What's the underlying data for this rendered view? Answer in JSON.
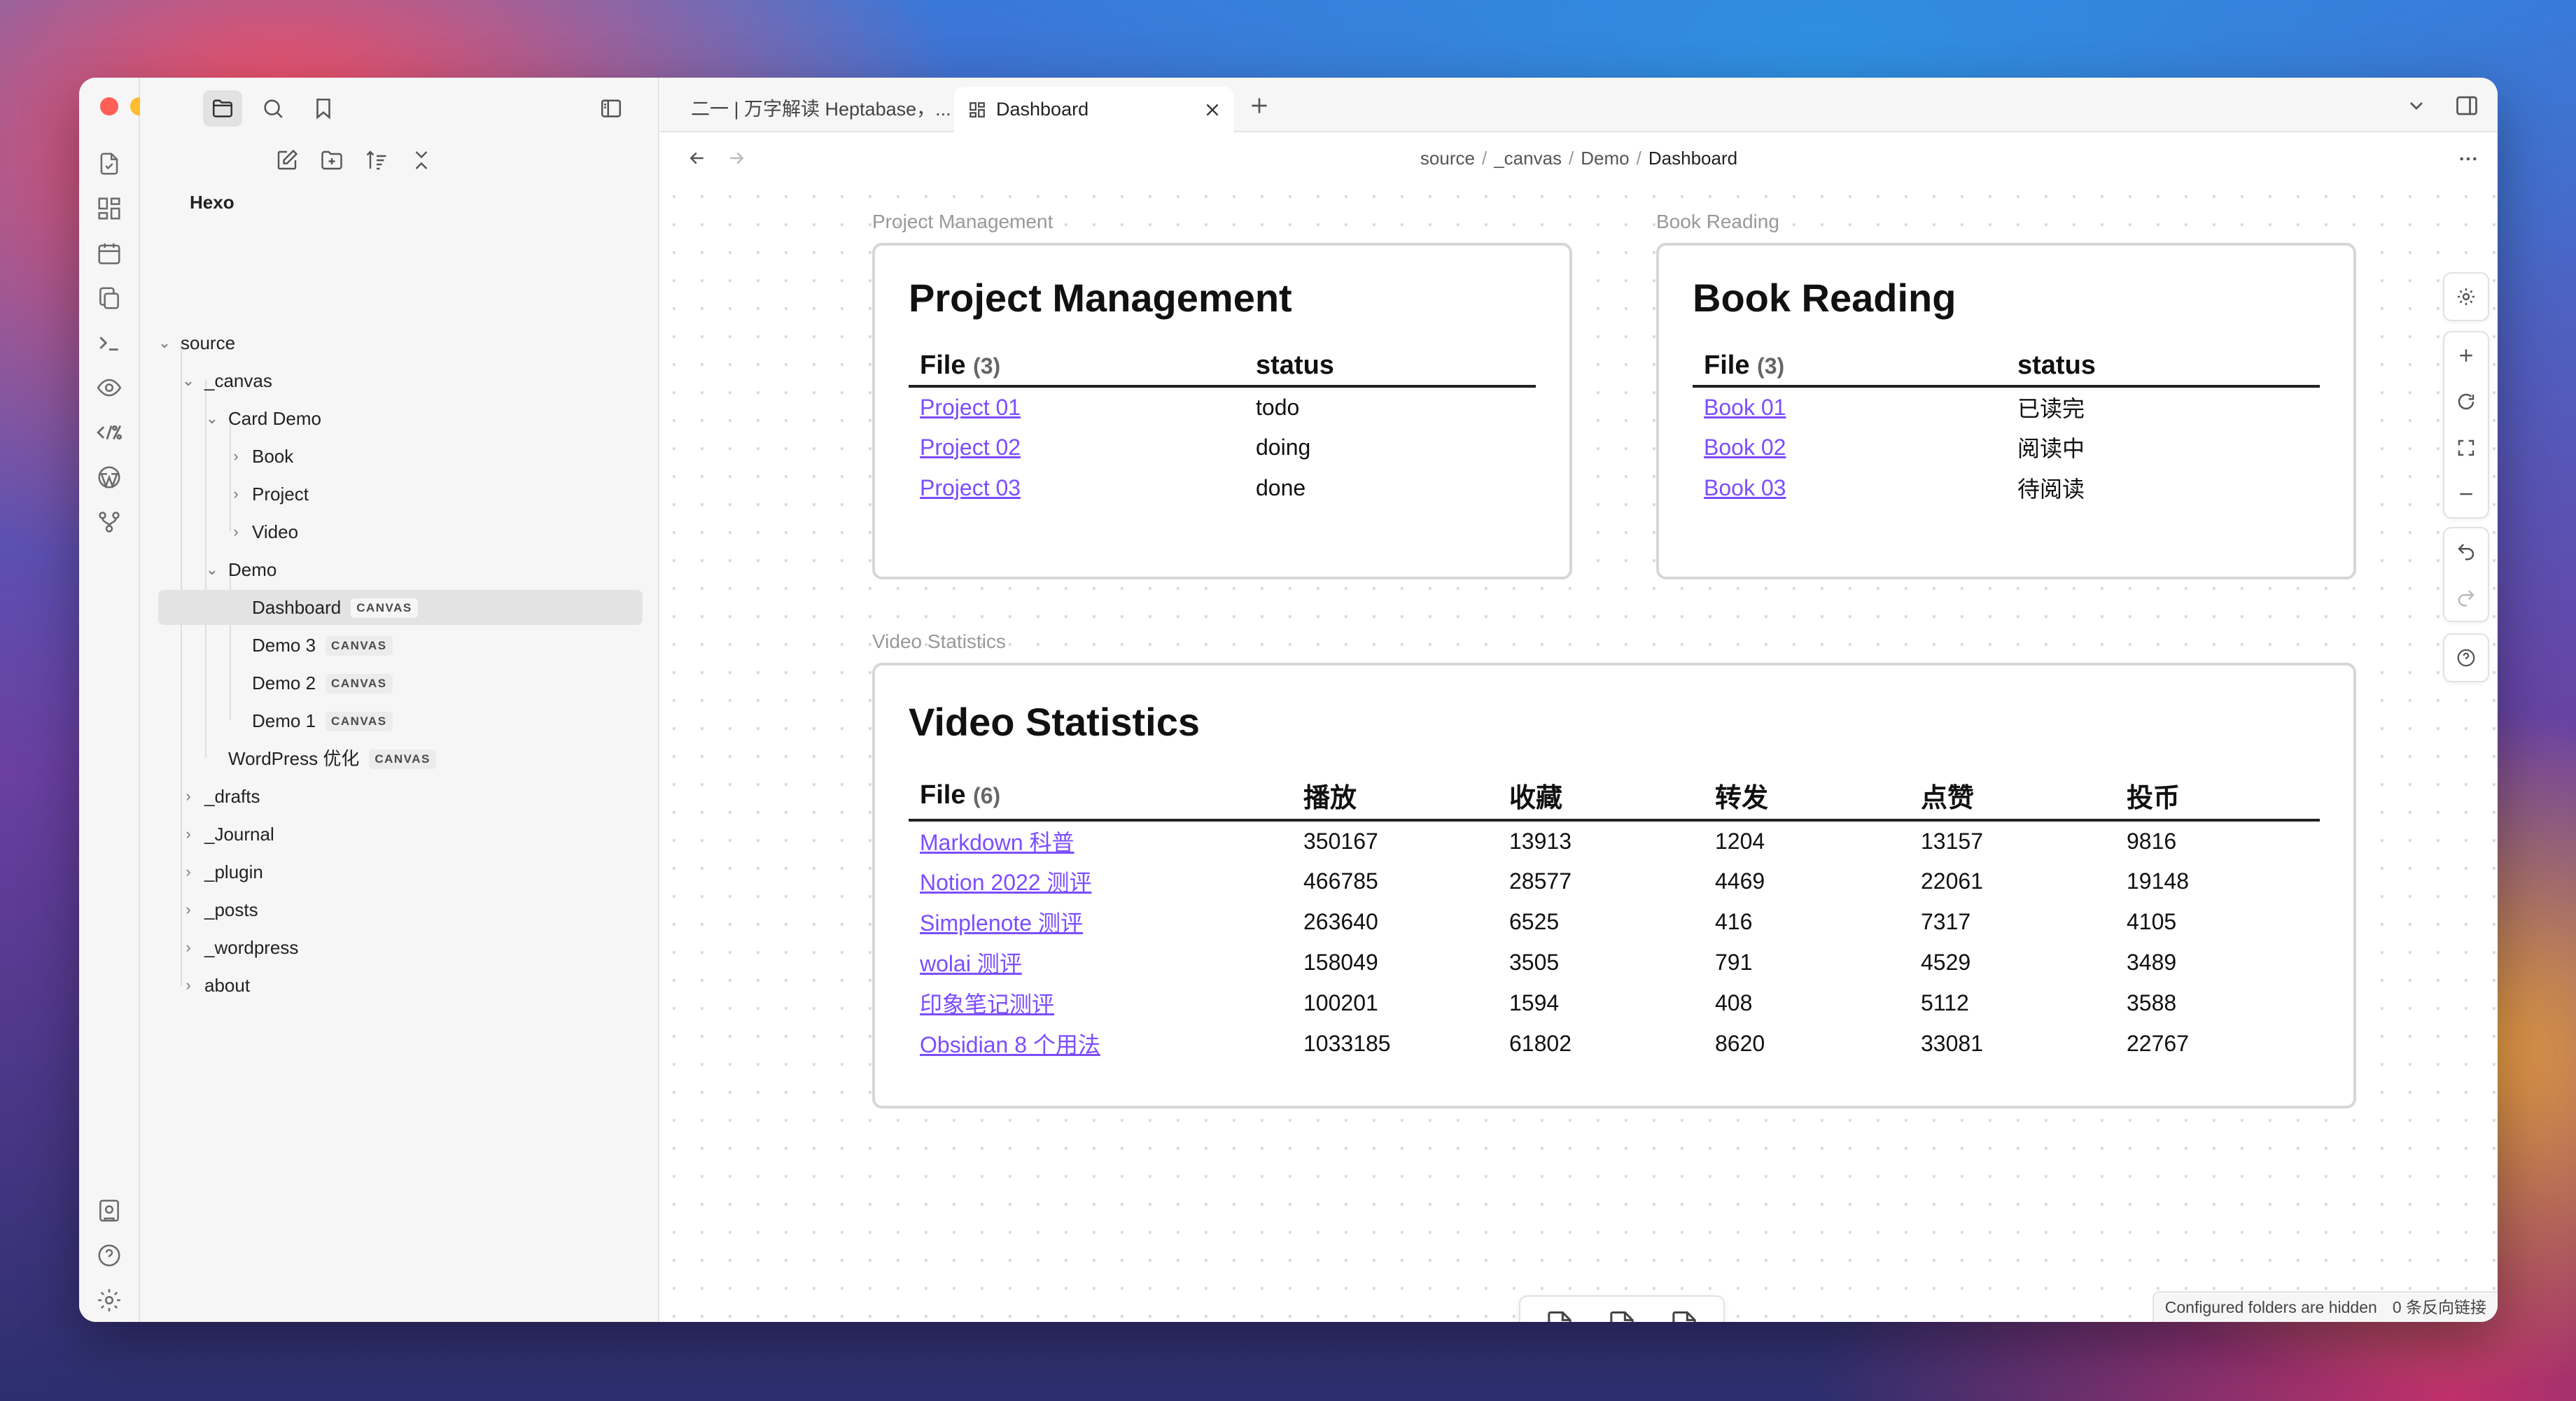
{
  "sidebar": {
    "root": "Hexo",
    "tree": [
      {
        "label": "source"
      },
      {
        "label": "_canvas"
      },
      {
        "label": "Card Demo"
      },
      {
        "label": "Book"
      },
      {
        "label": "Project"
      },
      {
        "label": "Video"
      },
      {
        "label": "Demo"
      },
      {
        "label": "Dashboard",
        "badge": "CANVAS"
      },
      {
        "label": "Demo 3",
        "badge": "CANVAS"
      },
      {
        "label": "Demo 2",
        "badge": "CANVAS"
      },
      {
        "label": "Demo 1",
        "badge": "CANVAS"
      },
      {
        "label": "WordPress 优化",
        "badge": "CANVAS"
      },
      {
        "label": "_drafts"
      },
      {
        "label": "_Journal"
      },
      {
        "label": "_plugin"
      },
      {
        "label": "_posts"
      },
      {
        "label": "_wordpress"
      },
      {
        "label": "about"
      }
    ]
  },
  "tabs": [
    {
      "label": "二一 | 万字解读 Heptabase，..."
    },
    {
      "label": "Dashboard"
    }
  ],
  "breadcrumb": [
    "source",
    "_canvas",
    "Demo",
    "Dashboard"
  ],
  "cards": {
    "project": {
      "node_label": "Project Management",
      "title": "Project Management",
      "headers": [
        "File",
        "status"
      ],
      "count": "(3)",
      "rows": [
        [
          "Project 01",
          "todo"
        ],
        [
          "Project 02",
          "doing"
        ],
        [
          "Project 03",
          "done"
        ]
      ]
    },
    "book": {
      "node_label": "Book Reading",
      "title": "Book Reading",
      "headers": [
        "File",
        "status"
      ],
      "count": "(3)",
      "rows": [
        [
          "Book 01",
          "已读完"
        ],
        [
          "Book 02",
          "阅读中"
        ],
        [
          "Book 03",
          "待阅读"
        ]
      ]
    },
    "video": {
      "node_label": "Video Statistics",
      "title": "Video Statistics",
      "headers": [
        "File",
        "播放",
        "收藏",
        "转发",
        "点赞",
        "投币"
      ],
      "count": "(6)",
      "rows": [
        [
          "Markdown 科普",
          "350167",
          "13913",
          "1204",
          "13157",
          "9816"
        ],
        [
          "Notion 2022 测评",
          "466785",
          "28577",
          "4469",
          "22061",
          "19148"
        ],
        [
          "Simplenote 测评",
          "263640",
          "6525",
          "416",
          "7317",
          "4105"
        ],
        [
          "wolai 测评",
          "158049",
          "3505",
          "791",
          "4529",
          "3489"
        ],
        [
          "印象笔记测评",
          "100201",
          "1594",
          "408",
          "5112",
          "3588"
        ],
        [
          "Obsidian 8 个用法",
          "1033185",
          "61802",
          "8620",
          "33081",
          "22767"
        ]
      ]
    }
  },
  "status_bar": {
    "hidden": "Configured folders are hidden",
    "backlinks": "0 条反向链接"
  },
  "colors": {
    "link": "#7c4dff",
    "traffic_red": "#ff5f57",
    "traffic_yellow": "#febc2e",
    "traffic_green": "#28c840"
  }
}
